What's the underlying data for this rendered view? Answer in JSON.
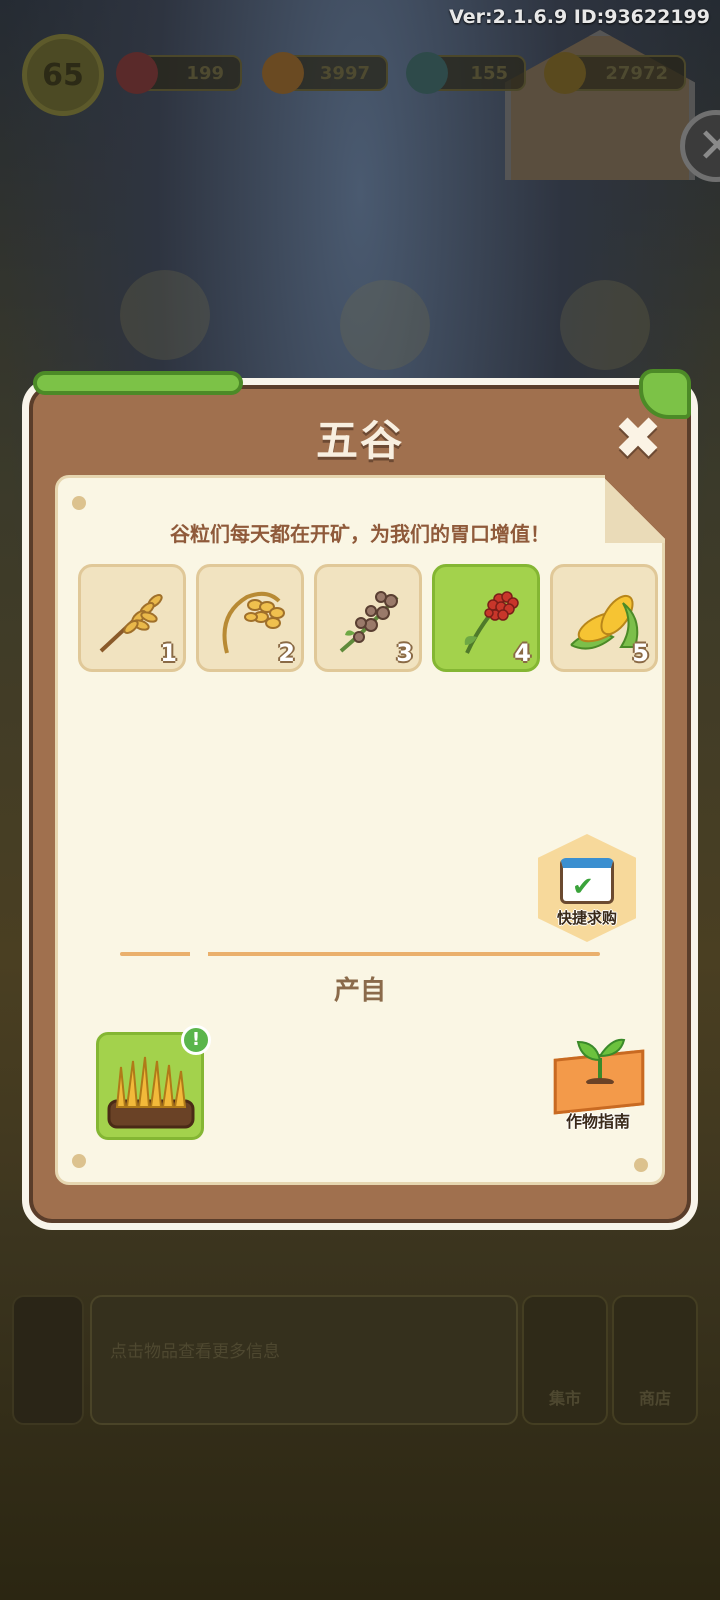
{
  "hud": {
    "version": "Ver:2.1.6.9 ID:93622199",
    "level": "65",
    "gems": "199",
    "carrots": "3997",
    "energy": "155",
    "coins": "27972"
  },
  "modal": {
    "title": "五谷",
    "subtitle": "谷粒们每天都在开矿，为我们的胃口增值！",
    "grains": [
      {
        "num": "1",
        "icon": "wheat-icon",
        "selected": false
      },
      {
        "num": "2",
        "icon": "barley-icon",
        "selected": false
      },
      {
        "num": "3",
        "icon": "buckwheat-icon",
        "selected": false
      },
      {
        "num": "4",
        "icon": "sorghum-icon",
        "selected": true
      },
      {
        "num": "5",
        "icon": "corn-icon",
        "selected": false
      }
    ],
    "quick_buy_label": "快捷求购",
    "produce_label": "产自",
    "crop_guide_label": "作物指南"
  },
  "bottom": {
    "info_text": "点击物品查看更多信息",
    "market_label": "集市",
    "shop_label": "商店"
  },
  "colors": {
    "modal_frame": "#a0704e",
    "paper": "#faf6e4",
    "selected_tile": "#a3d24c",
    "subtitle": "#8f5a3a"
  }
}
